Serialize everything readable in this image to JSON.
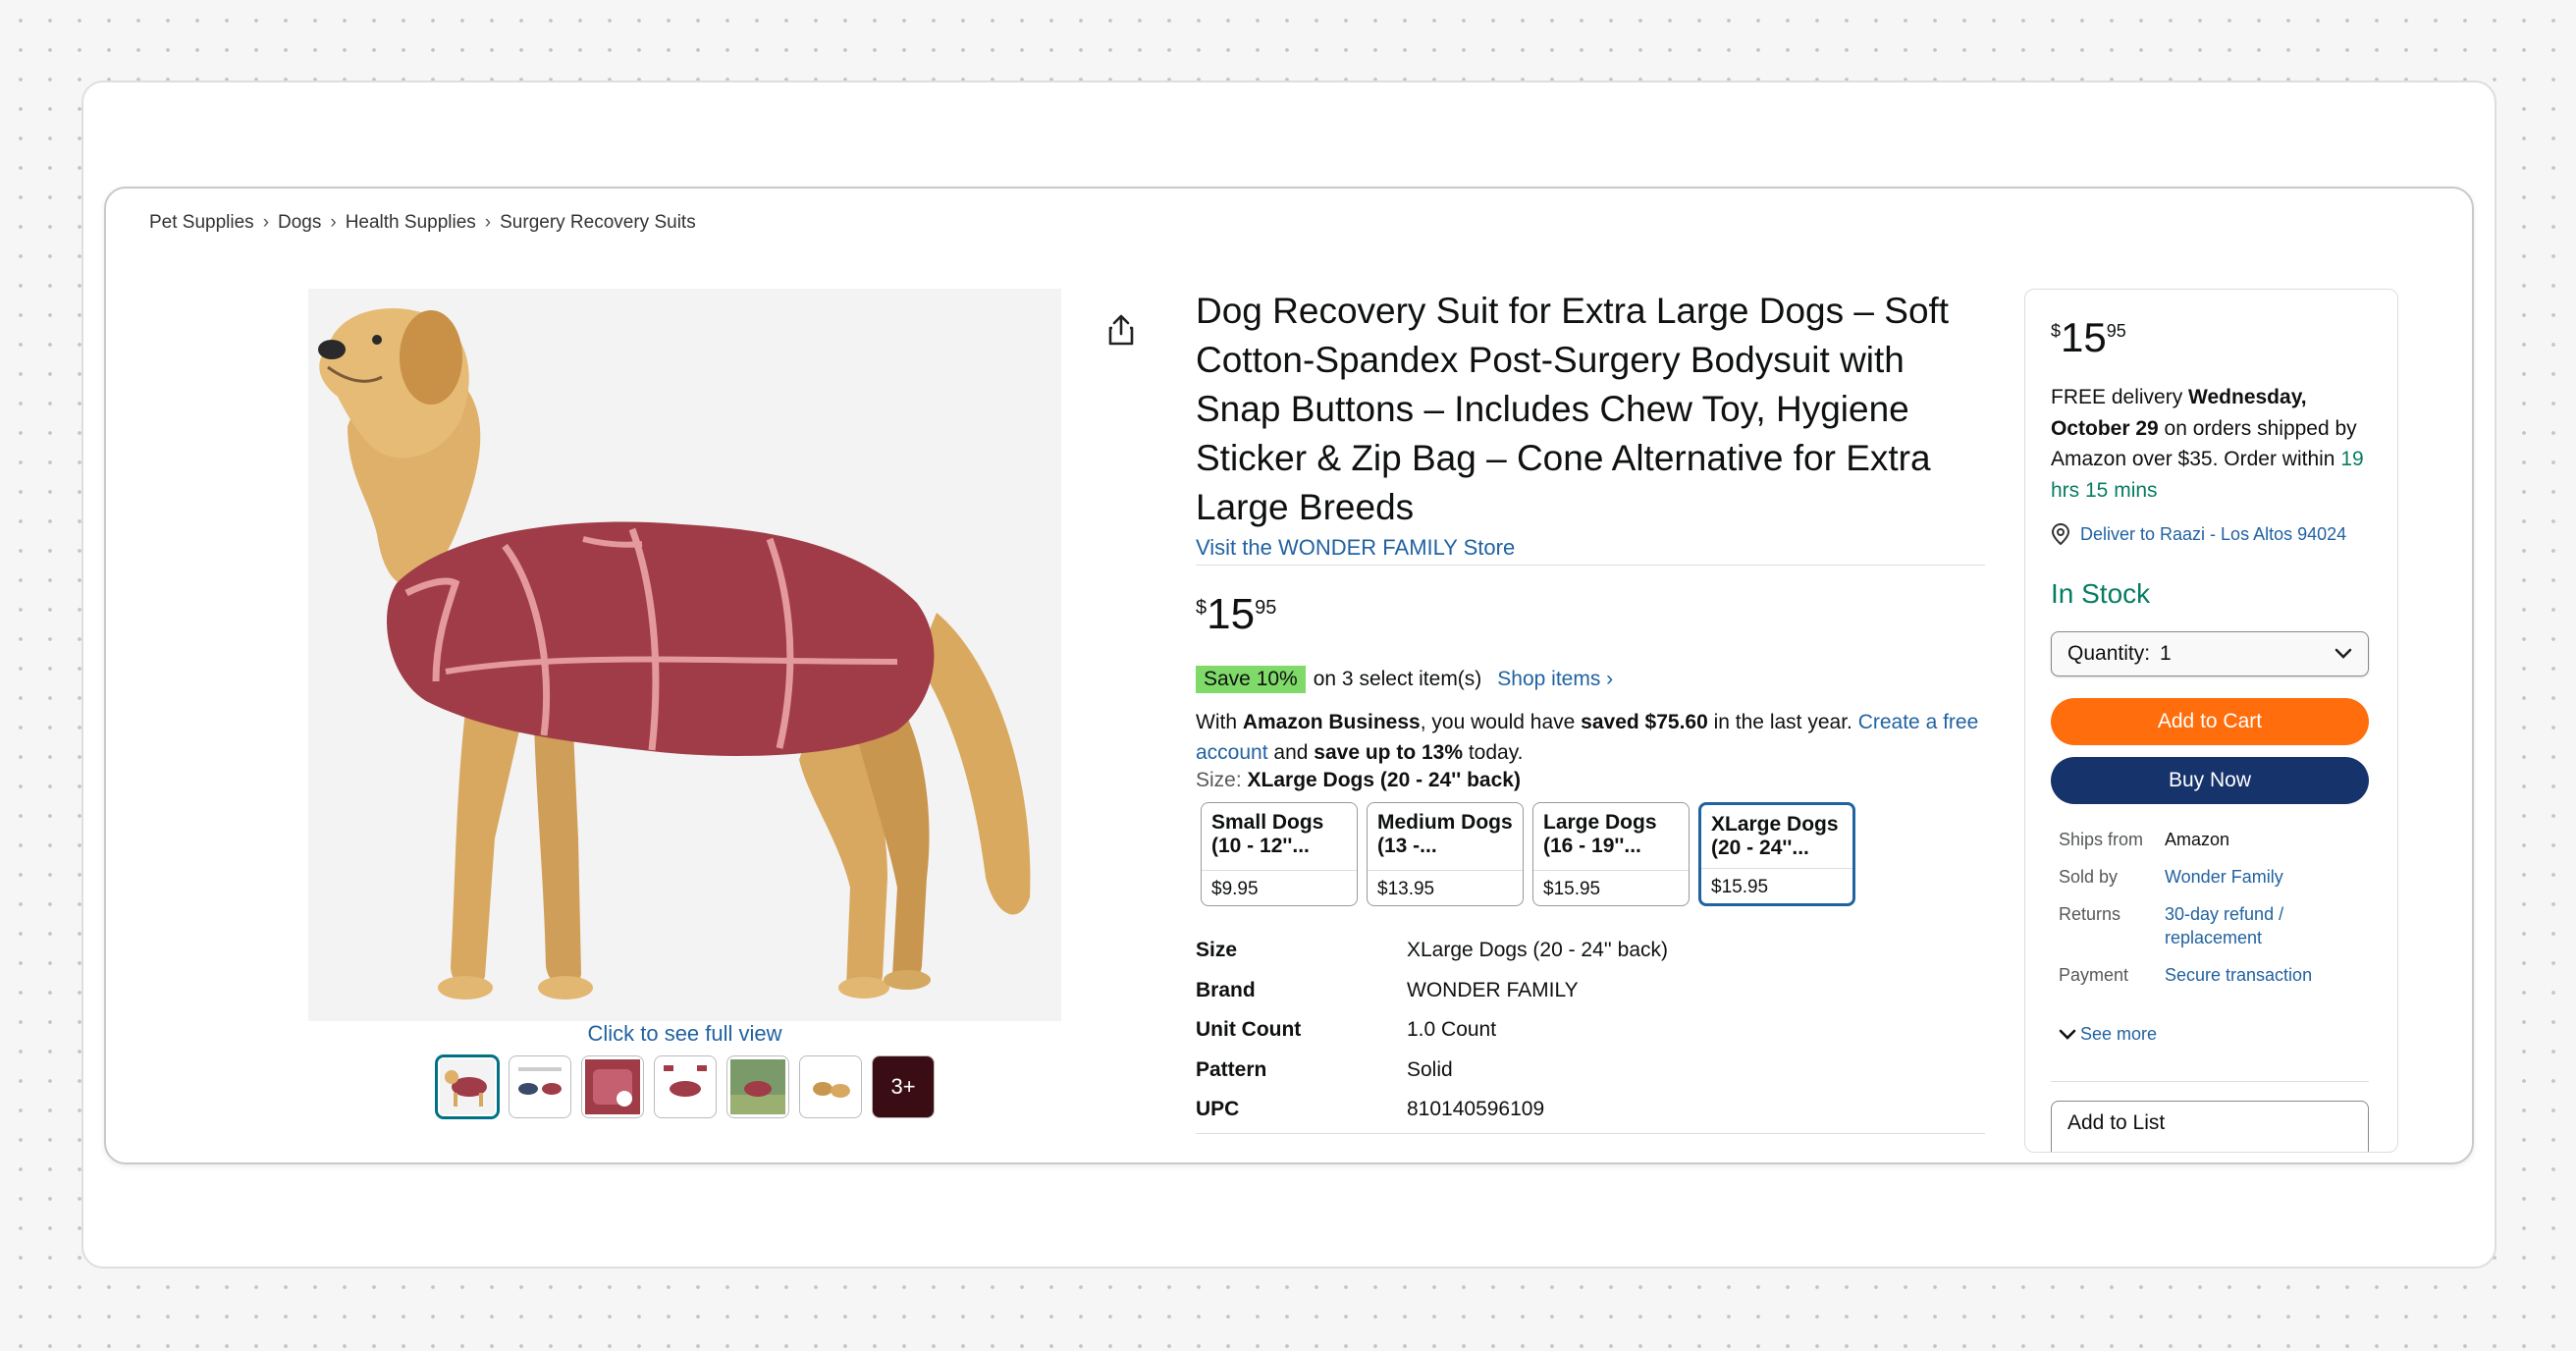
{
  "breadcrumb": [
    "Pet Supplies",
    "Dogs",
    "Health Supplies",
    "Surgery Recovery Suits"
  ],
  "gallery": {
    "full_view_label": "Click to see full view",
    "more_label": "3+"
  },
  "product": {
    "title": "Dog Recovery Suit for Extra Large Dogs – Soft Cotton-Spandex Post-Surgery Bodysuit with Snap Buttons – Includes Chew Toy, Hygiene Sticker & Zip Bag – Cone Alternative for Extra Large Breeds",
    "store_link": "Visit the WONDER FAMILY Store",
    "price": {
      "symbol": "$",
      "whole": "15",
      "fraction": "95"
    },
    "save_badge": "Save 10%",
    "save_text": "on 3 select item(s)",
    "shop_items": "Shop items ›",
    "business": {
      "p1": "With ",
      "b1": "Amazon Business",
      "p2": ", you would have ",
      "b2": "saved $75.60",
      "p3": " in the last year. ",
      "link": "Create a free account",
      "p4": " and ",
      "b3": "save up to 13%",
      "p5": " today."
    },
    "size_label": "Size: ",
    "size_selected": "XLarge Dogs (20 - 24'' back)",
    "sizes": [
      {
        "name": "Small Dogs (10 - 12''...",
        "price": "$9.95"
      },
      {
        "name": "Medium Dogs (13 -...",
        "price": "$13.95"
      },
      {
        "name": "Large Dogs (16 - 19''...",
        "price": "$15.95"
      },
      {
        "name": "XLarge Dogs (20 - 24''...",
        "price": "$15.95"
      }
    ],
    "specs": [
      {
        "k": "Size",
        "v": "XLarge Dogs (20 - 24'' back)"
      },
      {
        "k": "Brand",
        "v": "WONDER FAMILY"
      },
      {
        "k": "Unit Count",
        "v": "1.0 Count"
      },
      {
        "k": "Pattern",
        "v": "Solid"
      },
      {
        "k": "UPC",
        "v": "810140596109"
      }
    ]
  },
  "buybox": {
    "price": {
      "symbol": "$",
      "whole": "15",
      "fraction": "95"
    },
    "delivery": {
      "p1": "FREE delivery ",
      "b1": "Wednesday, October 29",
      "p2": " on orders shipped by Amazon over $35. Order within ",
      "time": "19 hrs 15 mins"
    },
    "location": "Deliver to Raazi - Los Altos 94024",
    "stock": "In Stock",
    "quantity_label": "Quantity:",
    "quantity_value": "1",
    "add_to_cart": "Add to Cart",
    "buy_now": "Buy Now",
    "info": [
      {
        "k": "Ships from",
        "v": "Amazon"
      },
      {
        "k": "Sold by",
        "v": "Wonder Family"
      },
      {
        "k": "Returns",
        "v": "30-day refund / replacement"
      },
      {
        "k": "Payment",
        "v": "Secure transaction"
      }
    ],
    "see_more": "See more",
    "add_to_list": "Add to List"
  },
  "colors": {
    "link": "#2162a1",
    "add_to_cart": "#ff6d0c",
    "buy_now": "#16336b",
    "in_stock": "#067d62",
    "save_badge": "#7fda69",
    "suit": "#a03c48"
  },
  "icons": [
    "share-icon",
    "location-pin-icon",
    "chevron-down-icon",
    "breadcrumb-separator-icon"
  ]
}
